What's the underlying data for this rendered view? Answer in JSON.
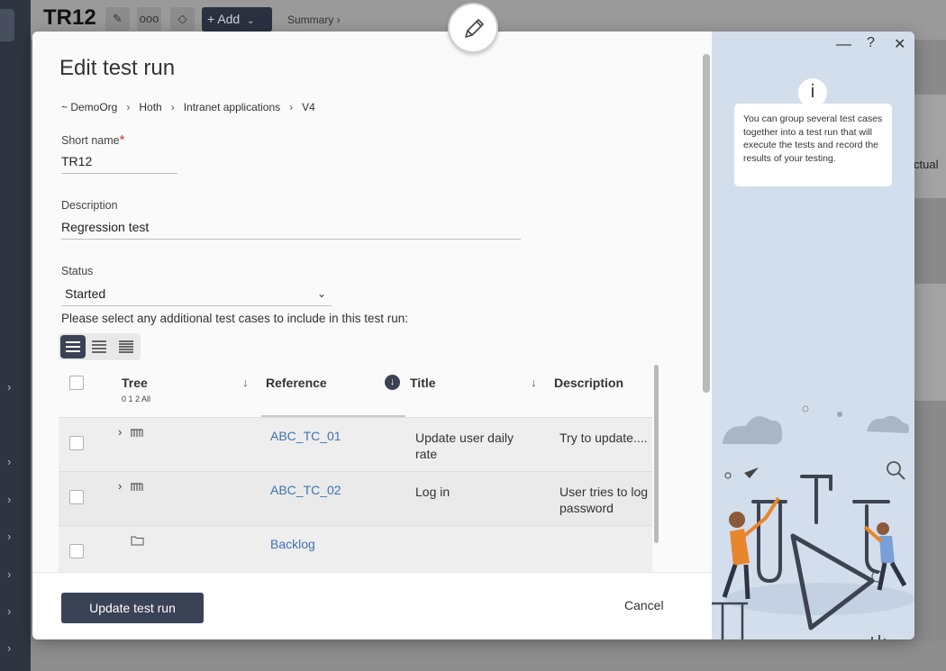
{
  "background": {
    "title": "TR12",
    "add_label": "Add",
    "summary_label": "Summary ›",
    "actual_label": "ctual"
  },
  "dialog": {
    "title": "Edit test run",
    "breadcrumb": [
      "~ DemoOrg",
      "Hoth",
      "Intranet applications",
      "V4"
    ],
    "short_name_label": "Short name",
    "short_name_required": "*",
    "short_name_value": "TR12",
    "description_label": "Description",
    "description_value": "Regression test",
    "status_label": "Status",
    "status_value": "Started",
    "instructions": "Please select any additional test cases to include in this test run:",
    "table": {
      "headers": {
        "tree": "Tree",
        "tree_levels": "0 1 2 All",
        "reference": "Reference",
        "title": "Title",
        "description": "Description"
      },
      "rows": [
        {
          "reference": "ABC_TC_01",
          "title_line1": "Update user daily",
          "title_line2": "rate",
          "description_line1": "Try to update....",
          "description_line2": "",
          "icon": "test-case-icon",
          "expandable": true
        },
        {
          "reference": "ABC_TC_02",
          "title_line1": "Log in",
          "title_line2": "",
          "description_line1": "User tries to log",
          "description_line2": "password",
          "icon": "test-case-icon",
          "expandable": true
        },
        {
          "reference": "Backlog",
          "title_line1": "",
          "title_line2": "",
          "description_line1": "",
          "description_line2": "",
          "icon": "folder-icon",
          "expandable": false
        }
      ]
    },
    "update_button": "Update test run",
    "cancel_button": "Cancel"
  },
  "side_panel": {
    "info_text": "You can group several test cases together into a test run that will execute the tests and record the results of your testing.",
    "info_marker": "i",
    "window_controls": {
      "minimize": "—",
      "help": "?",
      "close": "✕"
    }
  },
  "colors": {
    "primary": "#3a4255",
    "link": "#3d72b0",
    "side_panel_bg": "#d3deec",
    "required": "#d32f2f"
  }
}
